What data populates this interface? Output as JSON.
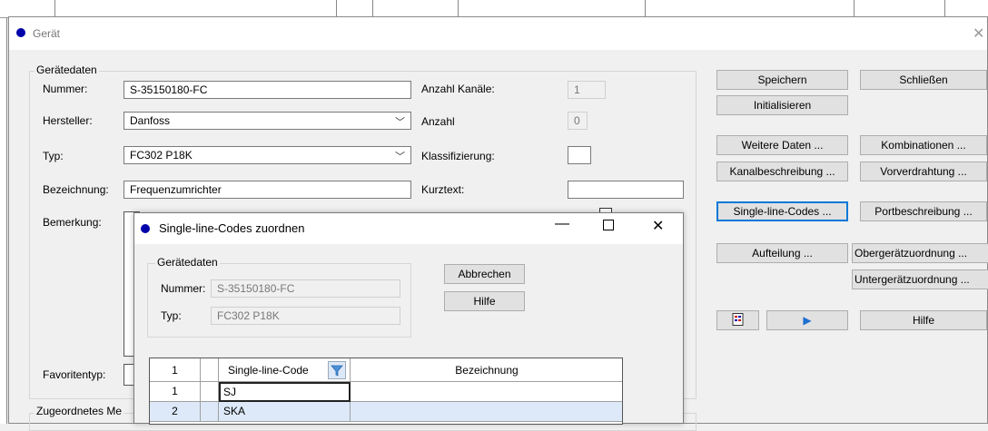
{
  "main_dialog": {
    "title": "Gerät",
    "group_title": "Gerätedaten",
    "labels": {
      "nummer": "Nummer:",
      "hersteller": "Hersteller:",
      "typ": "Typ:",
      "bezeichnung": "Bezeichnung:",
      "bemerkung": "Bemerkung:",
      "favoritentyp": "Favoritentyp:",
      "anzahl_kanaele": "Anzahl Kanäle:",
      "anzahl": "Anzahl",
      "klassifizierung": "Klassifizierung:",
      "kurztext": "Kurztext:"
    },
    "values": {
      "nummer": "S-35150180-FC",
      "hersteller": "Danfoss",
      "typ": "FC302 P18K",
      "bezeichnung": "Frequenzumrichter",
      "anzahl_kanaele": "1",
      "anzahl": "0",
      "kurztext": ""
    },
    "bottom_group_partial": "Zugeordnetes Me",
    "buttons": {
      "speichern": "Speichern",
      "schliessen": "Schließen",
      "initialisieren": "Initialisieren",
      "weitere_daten": "Weitere Daten ...",
      "kombinationen": "Kombinationen ...",
      "kanalbeschreibung": "Kanalbeschreibung ...",
      "vorverdrahtung": "Vorverdrahtung ...",
      "single_line_codes": "Single-line-Codes ...",
      "portbeschreibung": "Portbeschreibung ...",
      "aufteilung": "Aufteilung ...",
      "obergeraet": "Obergerätzuordnung ...",
      "untergeraet": "Untergerätzuordnung ...",
      "hilfe": "Hilfe"
    }
  },
  "sub_dialog": {
    "title": "Single-line-Codes zuordnen",
    "group_title": "Gerätedaten",
    "labels": {
      "nummer": "Nummer:",
      "typ": "Typ:"
    },
    "values": {
      "nummer": "S-35150180-FC",
      "typ": "FC302 P18K"
    },
    "buttons": {
      "abbrechen": "Abbrechen",
      "hilfe": "Hilfe"
    },
    "grid": {
      "corner": "1",
      "columns": [
        "Single-line-Code",
        "Bezeichnung"
      ],
      "rows": [
        {
          "index": "1",
          "code": "SJ",
          "bezeichnung": ""
        },
        {
          "index": "2",
          "code": "SKA",
          "bezeichnung": ""
        }
      ]
    }
  },
  "colors": {
    "title_dot": "#0000aa",
    "focus": "#0078d7",
    "row_selected": "#dde9f8"
  }
}
